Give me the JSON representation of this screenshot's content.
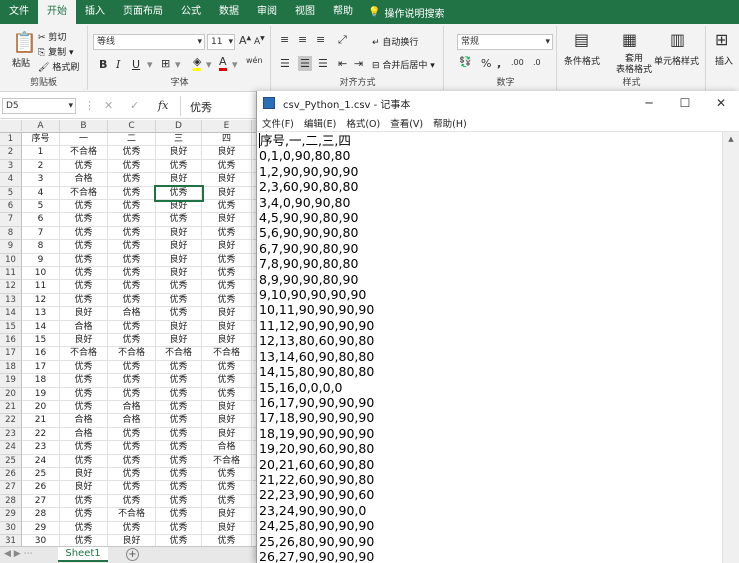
{
  "ribbon_tabs": [
    "文件",
    "开始",
    "插入",
    "页面布局",
    "公式",
    "数据",
    "审阅",
    "视图",
    "帮助"
  ],
  "active_tab": "开始",
  "tell_me": "操作说明搜索",
  "clipboard": {
    "paste": "粘贴",
    "cut": "剪切",
    "copy": "复制",
    "painter": "格式刷",
    "label": "剪贴板"
  },
  "font": {
    "name": "等线",
    "size": "11",
    "label": "字体",
    "bold": "B",
    "italic": "I",
    "underline": "U",
    "grow": "A",
    "shrink": "A",
    "color_a": "A",
    "wen": "wén"
  },
  "align": {
    "wrap": "自动换行",
    "merge": "合并后居中",
    "label": "对齐方式"
  },
  "number": {
    "format": "常规",
    "label": "数字",
    "pct": "%",
    "comma": ",",
    "dec_inc": ".00",
    "dec_dec": ".0"
  },
  "styles": {
    "cond": "条件格式",
    "table": "套用\n表格格式",
    "cell": "单元格样式",
    "label": "样式"
  },
  "cells": {
    "insert": "插入"
  },
  "formula_bar": {
    "name_box": "D5",
    "fx": "fx",
    "value": "优秀"
  },
  "columns": [
    "A",
    "B",
    "C",
    "D",
    "E"
  ],
  "rows": [
    [
      "序号",
      "一",
      "二",
      "三",
      "四"
    ],
    [
      "1",
      "不合格",
      "优秀",
      "良好",
      "良好"
    ],
    [
      "2",
      "优秀",
      "优秀",
      "优秀",
      "优秀"
    ],
    [
      "3",
      "合格",
      "优秀",
      "良好",
      "良好"
    ],
    [
      "4",
      "不合格",
      "优秀",
      "优秀",
      "良好"
    ],
    [
      "5",
      "优秀",
      "优秀",
      "良好",
      "优秀"
    ],
    [
      "6",
      "优秀",
      "优秀",
      "优秀",
      "良好"
    ],
    [
      "7",
      "优秀",
      "优秀",
      "良好",
      "优秀"
    ],
    [
      "8",
      "优秀",
      "优秀",
      "良好",
      "良好"
    ],
    [
      "9",
      "优秀",
      "优秀",
      "良好",
      "优秀"
    ],
    [
      "10",
      "优秀",
      "优秀",
      "良好",
      "优秀"
    ],
    [
      "11",
      "优秀",
      "优秀",
      "优秀",
      "优秀"
    ],
    [
      "12",
      "优秀",
      "优秀",
      "优秀",
      "优秀"
    ],
    [
      "13",
      "良好",
      "合格",
      "优秀",
      "良好"
    ],
    [
      "14",
      "合格",
      "优秀",
      "良好",
      "良好"
    ],
    [
      "15",
      "良好",
      "优秀",
      "良好",
      "良好"
    ],
    [
      "16",
      "不合格",
      "不合格",
      "不合格",
      "不合格"
    ],
    [
      "17",
      "优秀",
      "优秀",
      "优秀",
      "优秀"
    ],
    [
      "18",
      "优秀",
      "优秀",
      "优秀",
      "优秀"
    ],
    [
      "19",
      "优秀",
      "优秀",
      "优秀",
      "优秀"
    ],
    [
      "20",
      "优秀",
      "合格",
      "优秀",
      "良好"
    ],
    [
      "21",
      "合格",
      "合格",
      "优秀",
      "良好"
    ],
    [
      "22",
      "合格",
      "优秀",
      "优秀",
      "良好"
    ],
    [
      "23",
      "优秀",
      "优秀",
      "优秀",
      "合格"
    ],
    [
      "24",
      "优秀",
      "优秀",
      "优秀",
      "不合格"
    ],
    [
      "25",
      "良好",
      "优秀",
      "优秀",
      "优秀"
    ],
    [
      "26",
      "良好",
      "优秀",
      "优秀",
      "优秀"
    ],
    [
      "27",
      "优秀",
      "优秀",
      "优秀",
      "优秀"
    ],
    [
      "28",
      "优秀",
      "不合格",
      "优秀",
      "良好"
    ],
    [
      "29",
      "优秀",
      "优秀",
      "优秀",
      "良好"
    ],
    [
      "30",
      "优秀",
      "良好",
      "优秀",
      "优秀"
    ]
  ],
  "sheet_tab": "Sheet1",
  "add_sheet": "+",
  "notepad": {
    "title": "csv_Python_1.csv - 记事本",
    "menu": [
      "文件(F)",
      "编辑(E)",
      "格式(O)",
      "查看(V)",
      "帮助(H)"
    ],
    "lines": [
      "序号,一,二,三,四",
      "0,1,0,90,80,80",
      "1,2,90,90,90,90",
      "2,3,60,90,80,80",
      "3,4,0,90,90,80",
      "4,5,90,90,80,90",
      "5,6,90,90,90,80",
      "6,7,90,90,80,90",
      "7,8,90,90,80,80",
      "8,9,90,90,80,90",
      "9,10,90,90,90,90",
      "10,11,90,90,90,90",
      "11,12,90,90,90,90",
      "12,13,80,60,90,80",
      "13,14,60,90,80,80",
      "14,15,80,90,80,80",
      "15,16,0,0,0,0",
      "16,17,90,90,90,90",
      "17,18,90,90,90,90",
      "18,19,90,90,90,90",
      "19,20,90,60,90,80",
      "20,21,60,60,90,80",
      "21,22,60,90,90,80",
      "22,23,90,90,90,60",
      "23,24,90,90,90,0",
      "24,25,80,90,90,90",
      "25,26,80,90,90,90",
      "26,27,90,90,90,90"
    ]
  },
  "colors": {
    "excel_green": "#217346",
    "ribbon_bg": "#f3f3f3",
    "header_bg": "#efefef"
  }
}
